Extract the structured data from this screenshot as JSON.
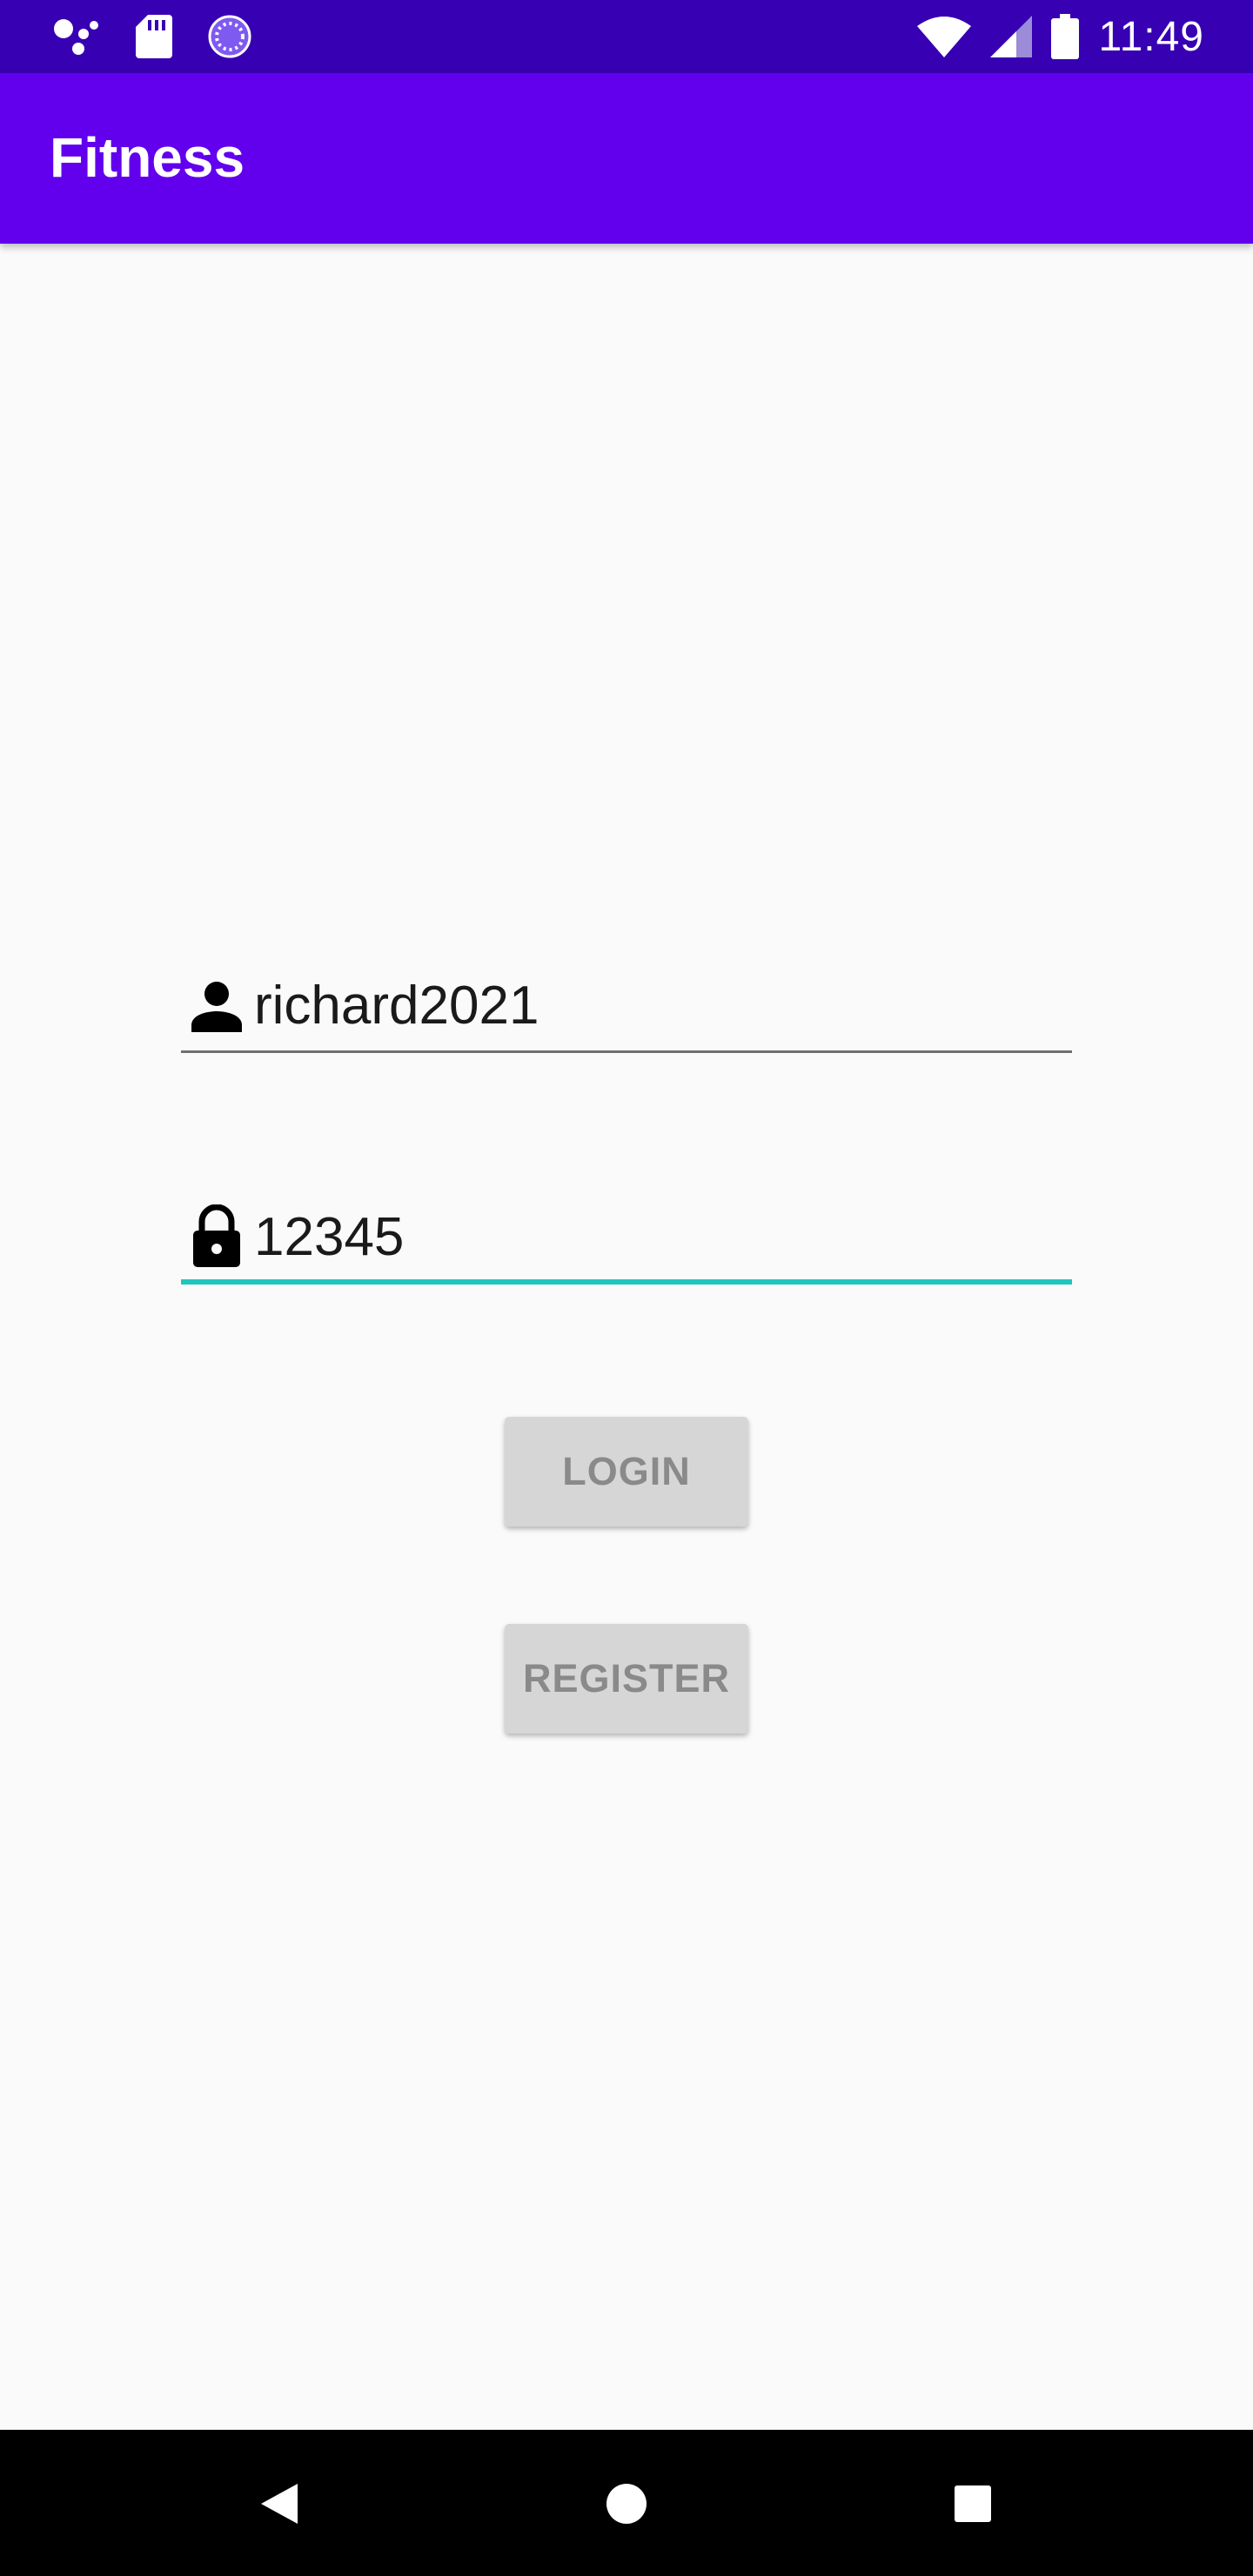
{
  "status_bar": {
    "time": "11:49",
    "icons": [
      "assistant-icon",
      "sd-card-icon",
      "sync-icon",
      "wifi-icon",
      "signal-icon",
      "battery-icon"
    ]
  },
  "app_bar": {
    "title": "Fitness",
    "color": "#6200ee",
    "status_color": "#3700b3"
  },
  "login_form": {
    "username": {
      "value": "richard2021",
      "icon": "person-icon"
    },
    "password": {
      "value": "12345",
      "icon": "lock-icon",
      "focused": true,
      "accent": "#1fc6bd"
    },
    "login_label": "LOGIN",
    "register_label": "REGISTER"
  },
  "nav_bar": {
    "buttons": [
      "back-icon",
      "home-icon",
      "recents-icon"
    ]
  }
}
